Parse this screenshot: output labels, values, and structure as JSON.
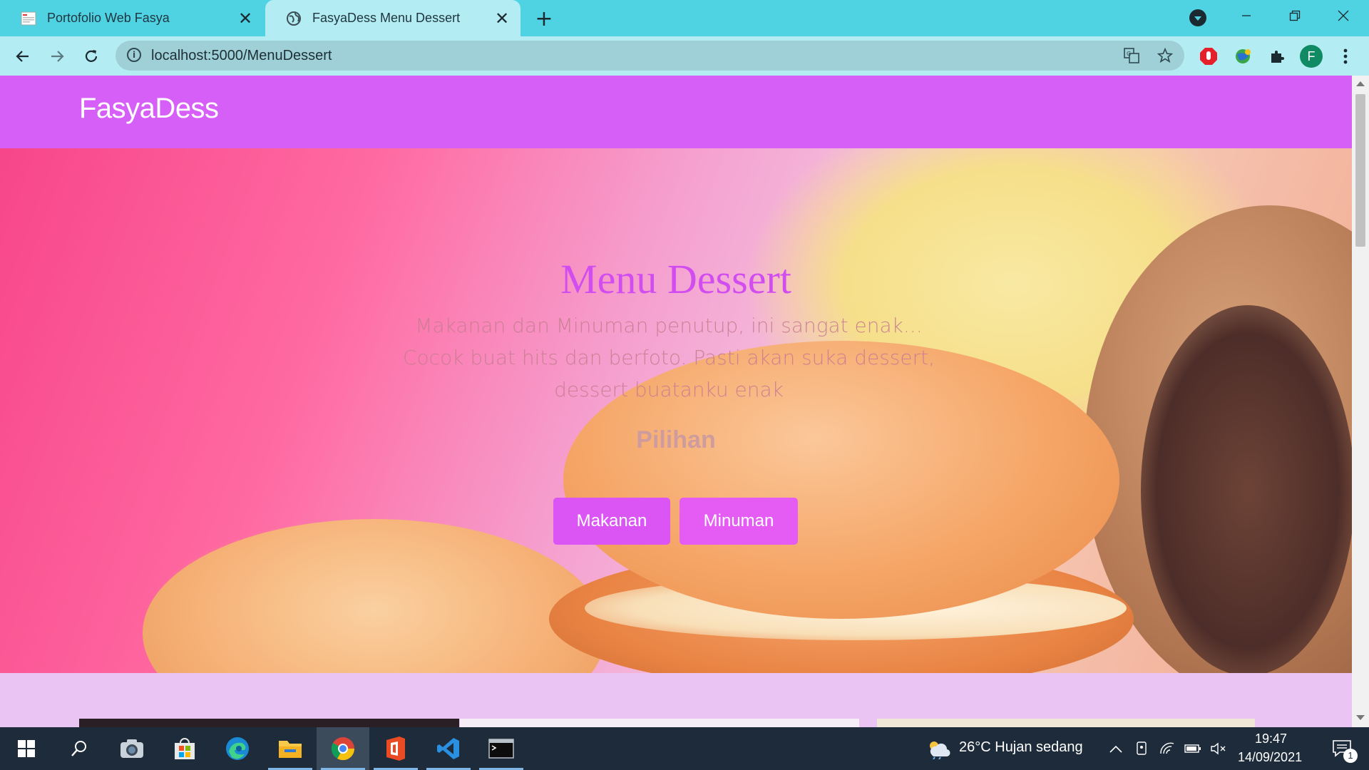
{
  "browser": {
    "tabs": [
      {
        "title": "Portofolio Web Fasya",
        "active": false
      },
      {
        "title": "FasyaDess Menu Dessert",
        "active": true
      }
    ],
    "url": "localhost:5000/MenuDessert",
    "profile_initial": "F"
  },
  "page": {
    "brand": "FasyaDess",
    "hero": {
      "title": "Menu Dessert",
      "description_line1": "Makanan dan Minuman penutup, ini sangat enak...",
      "description_line2": "Cocok buat hits dan berfoto. Pasti akan suka dessert, dessert buatanku enak",
      "subtitle": "Pilihan",
      "buttons": [
        "Makanan",
        "Minuman"
      ]
    }
  },
  "taskbar": {
    "weather": "26°C  Hujan sedang",
    "time": "19:47",
    "date": "14/09/2021",
    "notification_count": "1"
  },
  "colors": {
    "tabstrip": "#4fd3e3",
    "toolbar": "#b3ecf3",
    "navbar": "#d65ff8",
    "title": "#d24df0",
    "button": "#db55f5"
  }
}
